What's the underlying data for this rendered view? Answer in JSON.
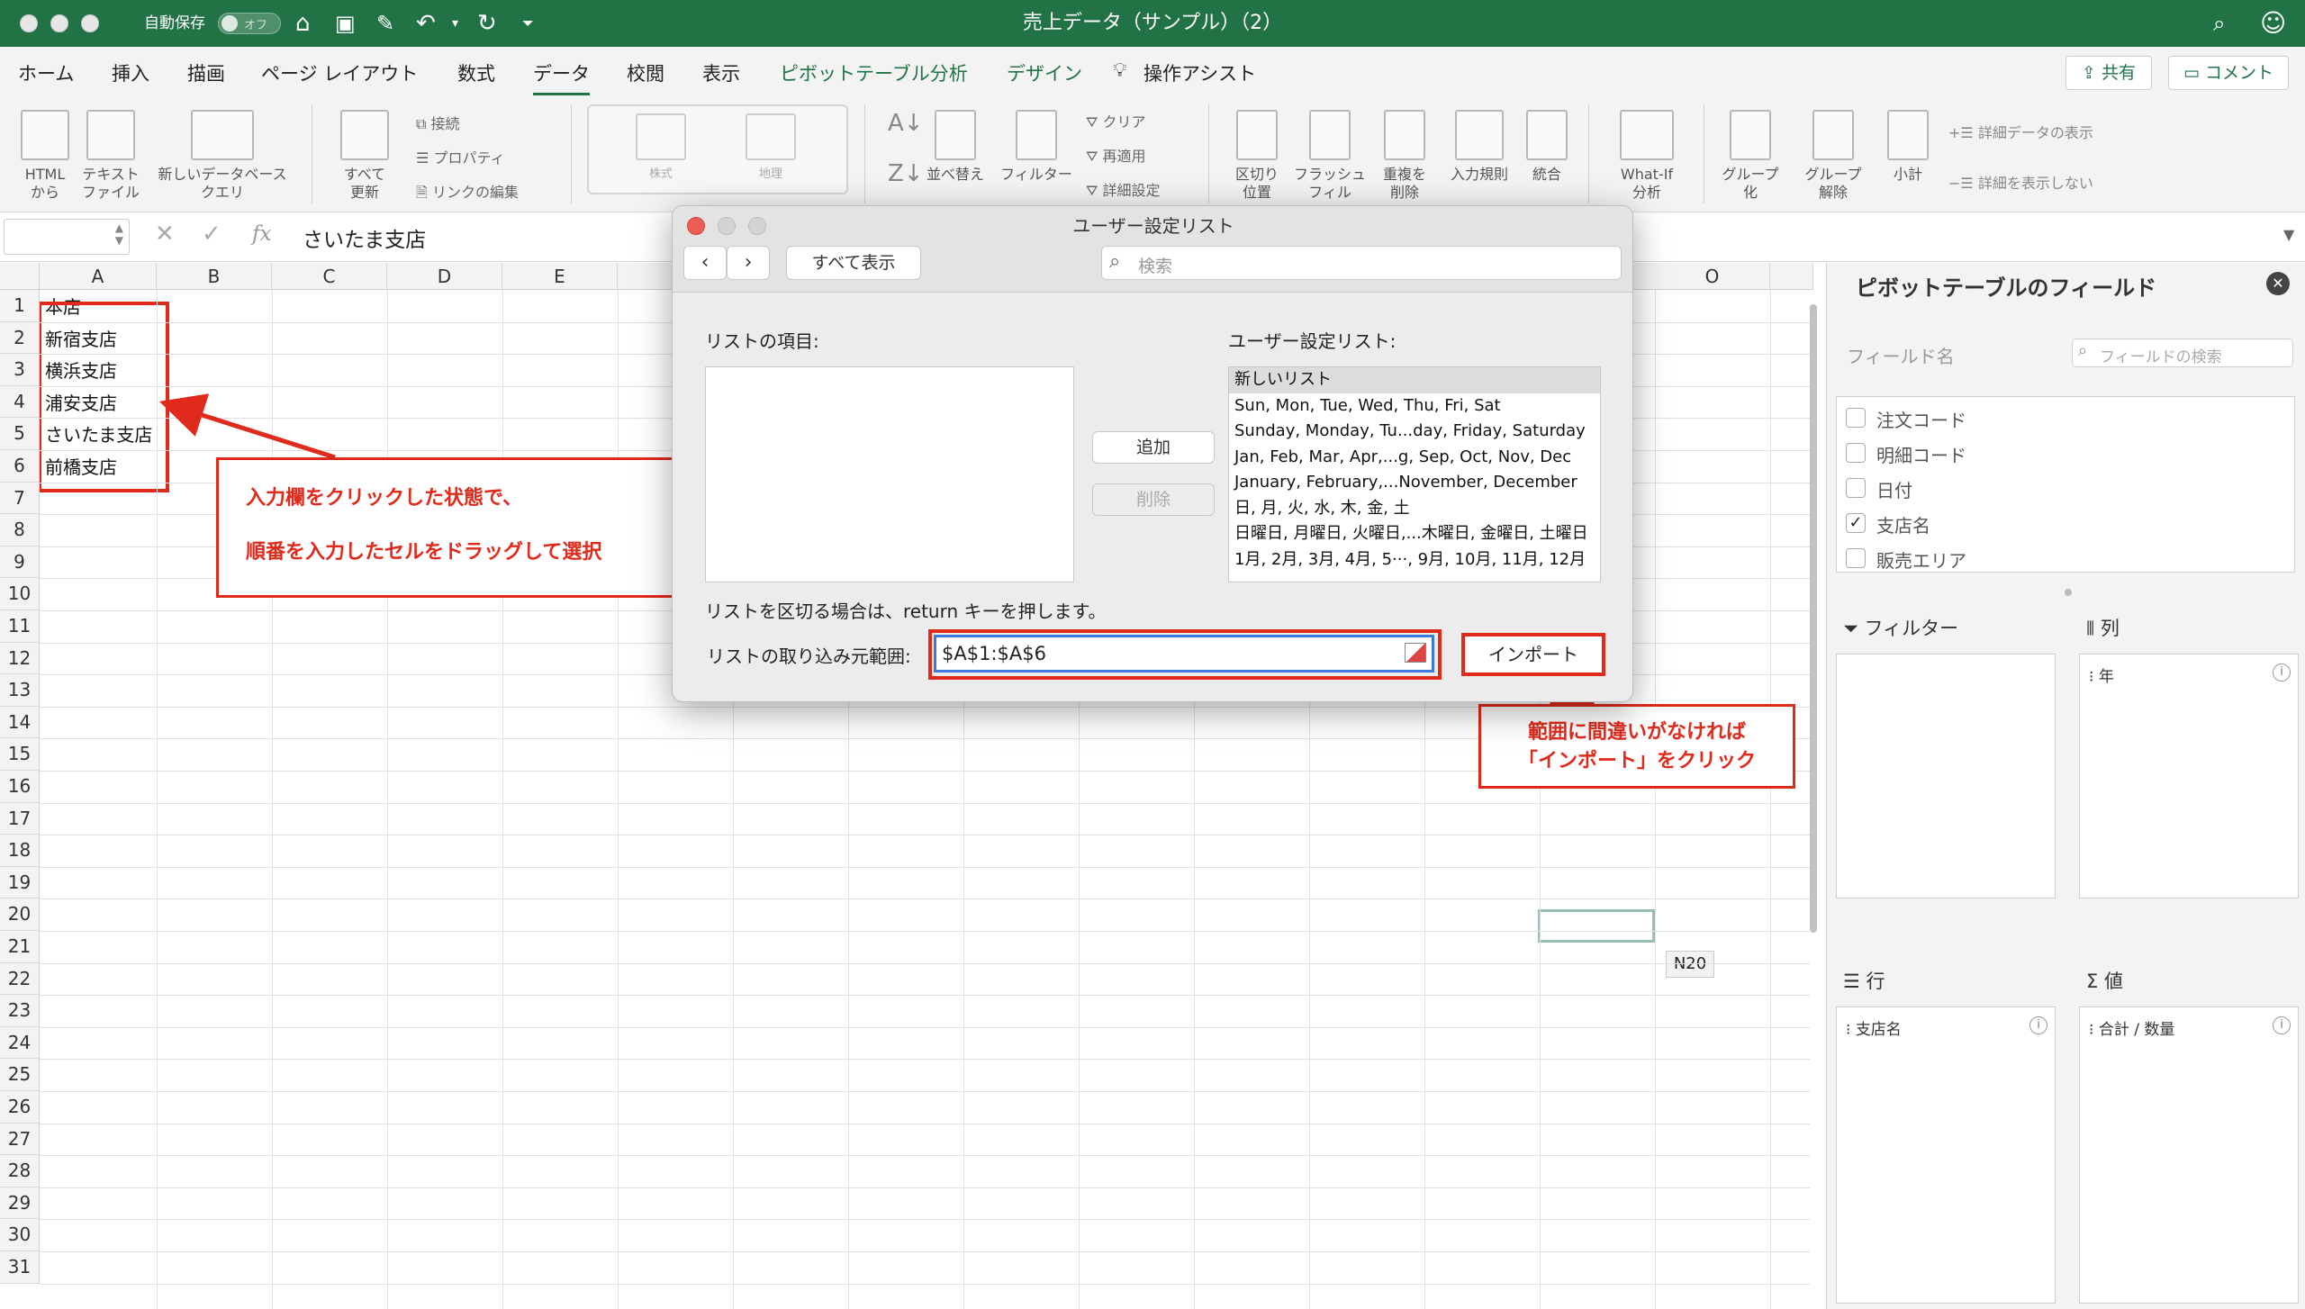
{
  "titlebar": {
    "autosave_label": "自動保存",
    "autosave_state": "オフ",
    "document_title": "売上データ（サンプル）（2）"
  },
  "ribbon_tabs": [
    "ホーム",
    "挿入",
    "描画",
    "ページ レイアウト",
    "数式",
    "データ",
    "校閲",
    "表示",
    "ピボットテーブル分析",
    "デザイン",
    "操作アシスト"
  ],
  "active_tab": "データ",
  "share_label": "共有",
  "comment_label": "コメント",
  "ribbon": {
    "html": "HTML\nから",
    "text_file": "テキスト\nファイル",
    "new_db_query": "新しいデータベース\nクエリ",
    "refresh_all": "すべて\n更新",
    "connections": "接続",
    "properties": "プロパティ",
    "edit_links": "リンクの編集",
    "stocks": "株式",
    "geography": "地理",
    "sort": "並べ替え",
    "filter": "フィルター",
    "clear": "クリア",
    "reapply": "再適用",
    "advanced": "詳細設定",
    "text_to_columns": "区切り\n位置",
    "flash_fill": "フラッシュ\nフィル",
    "remove_duplicates": "重複を\n削除",
    "data_validation": "入力規則",
    "consolidate": "統合",
    "what_if": "What-If\n分析",
    "group": "グループ\n化",
    "ungroup": "グループ\n解除",
    "subtotal": "小計",
    "show_detail": "詳細データの表示",
    "hide_detail": "詳細を表示しない"
  },
  "formula_bar": {
    "fx": "fx",
    "value": "さいたま支店"
  },
  "columns": [
    "A",
    "B",
    "C",
    "D",
    "E",
    "O"
  ],
  "rows": [
    "1",
    "2",
    "3",
    "4",
    "5",
    "6",
    "7",
    "8",
    "9",
    "10",
    "11",
    "12",
    "13",
    "14",
    "15",
    "16",
    "17",
    "18",
    "19",
    "20",
    "21",
    "22",
    "23",
    "24",
    "25",
    "26",
    "27",
    "28",
    "29",
    "30",
    "31"
  ],
  "cells_A": [
    "本店",
    "新宿支店",
    "横浜支店",
    "浦安支店",
    "さいたま支店",
    "前橋支店"
  ],
  "cell_tooltip": "N20",
  "dialog": {
    "title": "ユーザー設定リスト",
    "show_all": "すべて表示",
    "search_placeholder": "検索",
    "list_items_label": "リストの項目:",
    "custom_lists_label": "ユーザー設定リスト:",
    "add": "追加",
    "delete": "削除",
    "custom_lists": [
      "新しいリスト",
      "Sun, Mon, Tue, Wed, Thu, Fri, Sat",
      "Sunday, Monday, Tu...day, Friday, Saturday",
      "Jan, Feb, Mar, Apr,...g, Sep, Oct, Nov, Dec",
      "January, February,...November, December",
      "日, 月, 火, 水, 木, 金, 土",
      "日曜日, 月曜日, 火曜日,...木曜日, 金曜日, 土曜日",
      "1月, 2月, 3月, 4月, 5···, 9月, 10月, 11月, 12月"
    ],
    "hint": "リストを区切る場合は、return キーを押します。",
    "import_range_label": "リストの取り込み元範囲:",
    "import_range_value": "$A$1:$A$6",
    "import_button": "インポート"
  },
  "annotations": {
    "callout1_line1": "入力欄をクリックした状態で、",
    "callout1_line2": "順番を入力したセルをドラッグして選択",
    "callout2_line1": "範囲に間違いがなければ",
    "callout2_line2": "「インポート」をクリック",
    "color": "#e02a1b"
  },
  "pivot_pane": {
    "title": "ピボットテーブルのフィールド",
    "field_name_label": "フィールド名",
    "field_search_placeholder": "フィールドの検索",
    "fields": [
      {
        "label": "注文コード",
        "checked": false
      },
      {
        "label": "明細コード",
        "checked": false
      },
      {
        "label": "日付",
        "checked": false
      },
      {
        "label": "支店名",
        "checked": true
      },
      {
        "label": "販売エリア",
        "checked": false
      }
    ],
    "filter_label": "フィルター",
    "columns_label": "列",
    "rows_label": "行",
    "values_label": "値",
    "columns_item": "年",
    "rows_item": "支店名",
    "values_item": "合計 / 数量"
  },
  "colors": {
    "excel_green": "#217346",
    "selection_border": "#3a7ad9"
  }
}
